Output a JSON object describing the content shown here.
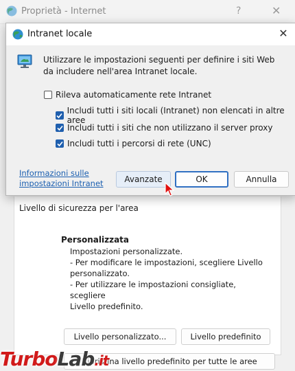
{
  "background_window": {
    "title": "Proprietà - Internet",
    "help_glyph": "?",
    "close_glyph": "✕",
    "zone_security_label": "Livello di sicurezza per l'area",
    "custom_title": "Personalizzata",
    "custom_description": [
      "Impostazioni personalizzate.",
      "- Per modificare le impostazioni, scegliere Livello",
      "personalizzato.",
      "- Per utilizzare le impostazioni consigliate, scegliere",
      "Livello predefinito."
    ],
    "buttons": {
      "custom_level": "Livello personalizzato...",
      "default_level": "Livello predefinito",
      "reset_all": "Ripristina livello predefinito per tutte le aree"
    }
  },
  "dialog": {
    "title": "Intranet locale",
    "close_glyph": "✕",
    "description": "Utilizzare le impostazioni seguenti per definire i siti Web da includere nell'area Intranet locale.",
    "checkboxes": [
      {
        "label": "Rileva automaticamente rete Intranet",
        "checked": false
      },
      {
        "label": "Includi tutti i siti locali (Intranet) non elencati in altre aree",
        "checked": true
      },
      {
        "label": "Includi tutti i siti che non utilizzano il server proxy",
        "checked": true
      },
      {
        "label": "Includi tutti i percorsi di rete (UNC)",
        "checked": true
      }
    ],
    "help_link": "Informazioni sulle impostazioni Intranet",
    "buttons": {
      "advanced": "Avanzate",
      "ok": "OK",
      "cancel": "Annulla"
    }
  },
  "watermark": {
    "part1": "Turbo",
    "part2": "Lab",
    "part3": ".it"
  },
  "colors": {
    "accent": "#1f5fae",
    "link": "#1b5fb0",
    "watermark_red": "#d11a1a"
  }
}
